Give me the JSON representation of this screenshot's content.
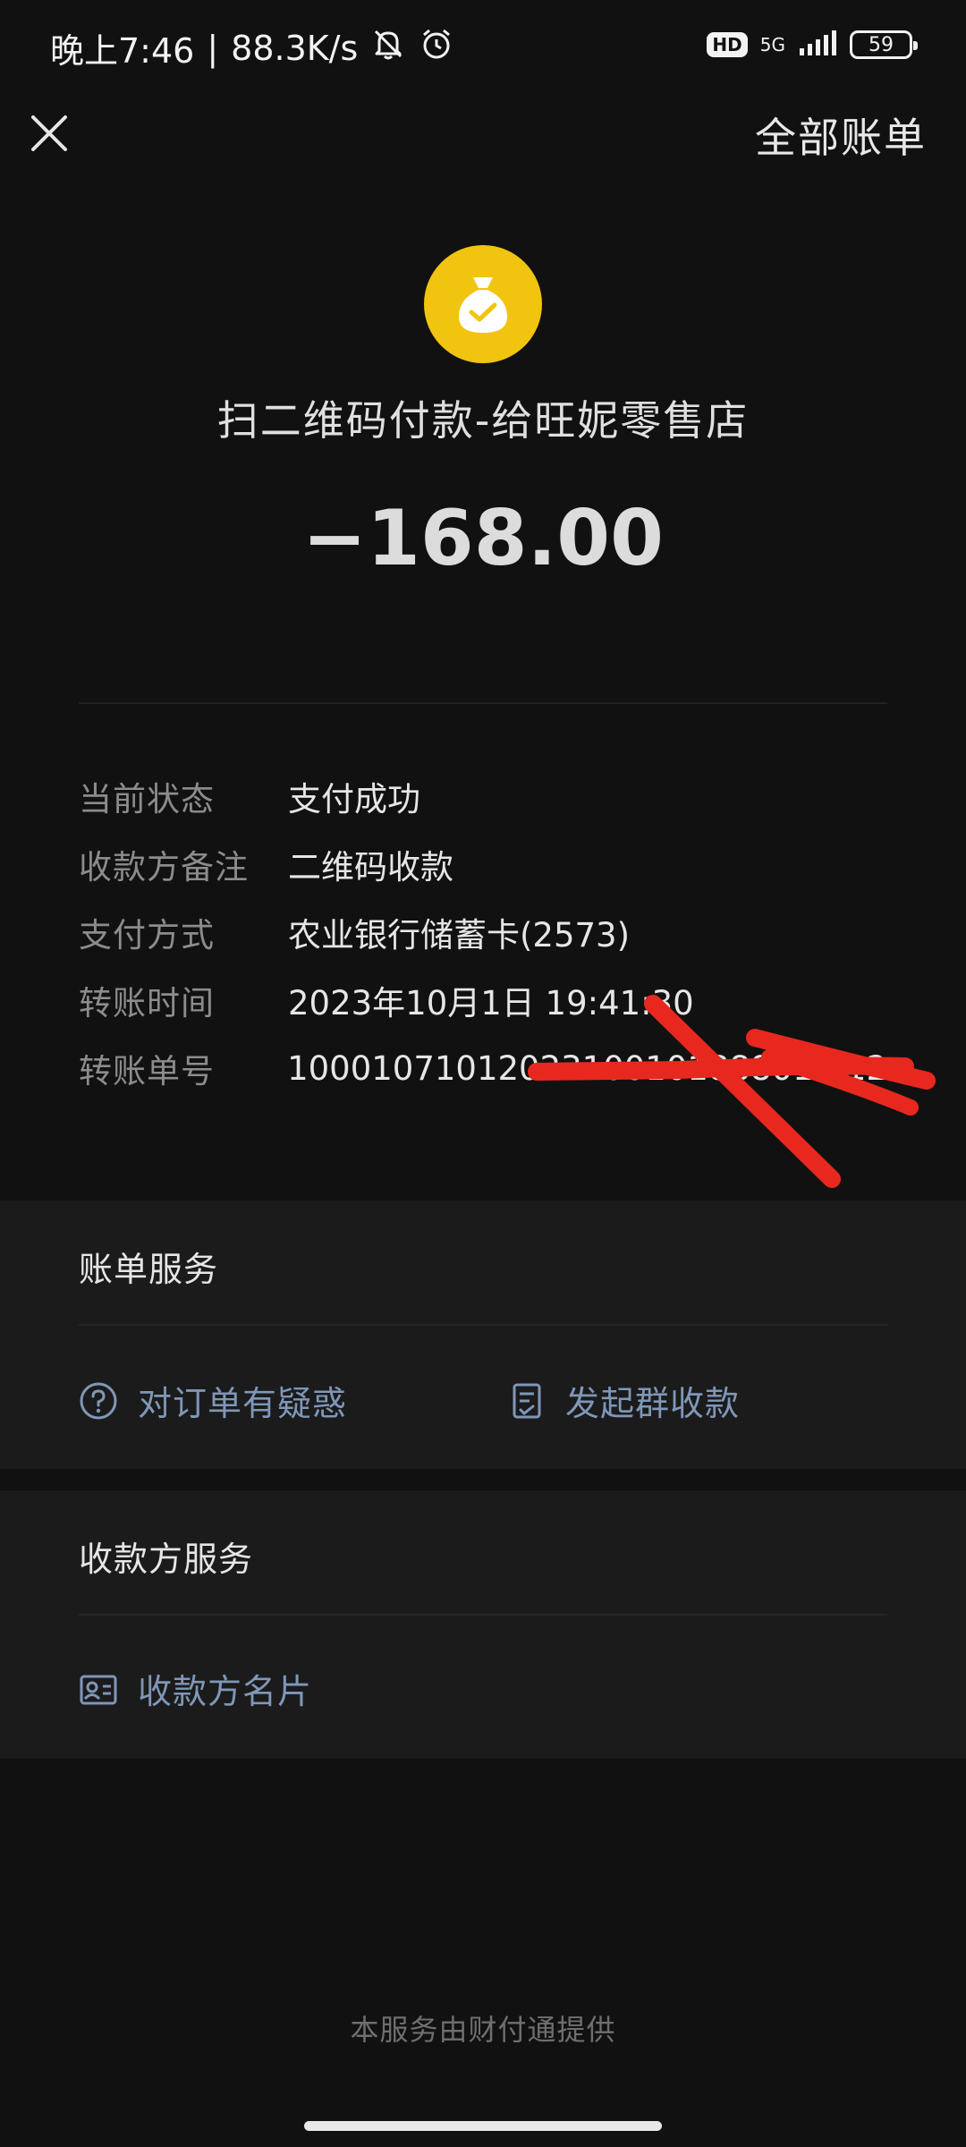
{
  "status_bar": {
    "time": "晚上7:46",
    "separator": "|",
    "net_speed": "88.3K/s",
    "hd_label": "HD",
    "net_type": "5G",
    "battery": "59",
    "icons": [
      "mute-icon",
      "alarm-icon",
      "signal-icon"
    ]
  },
  "header": {
    "close_icon": "close-icon",
    "all_bills_label": "全部账单"
  },
  "transaction": {
    "merchant_name": "扫二维码付款-给旺妮零售店",
    "amount": "−168.00",
    "logo_icon": "money-bag-check-icon",
    "logo_color": "#f1c40f"
  },
  "details": [
    {
      "label": "当前状态",
      "value": "支付成功"
    },
    {
      "label": "收款方备注",
      "value": "二维码收款"
    },
    {
      "label": "支付方式",
      "value": "农业银行储蓄卡(2573)"
    },
    {
      "label": "转账时间",
      "value": "2023年10月1日 19:41:30"
    },
    {
      "label": "转账单号",
      "value": "10001071012023100101888012     12"
    }
  ],
  "bill_services": {
    "title": "账单服务",
    "items": [
      {
        "label": "对订单有疑惑",
        "icon": "question-circle-icon"
      },
      {
        "label": "发起群收款",
        "icon": "checklist-icon"
      }
    ]
  },
  "payee_services": {
    "title": "收款方服务",
    "items": [
      {
        "label": "收款方名片",
        "icon": "contact-card-icon"
      }
    ]
  },
  "footer": {
    "text": "本服务由财付通提供"
  },
  "colors": {
    "background": "#111111",
    "card": "#1b1b1b",
    "link": "#7f97b8",
    "annotation_red": "#e8281e"
  }
}
